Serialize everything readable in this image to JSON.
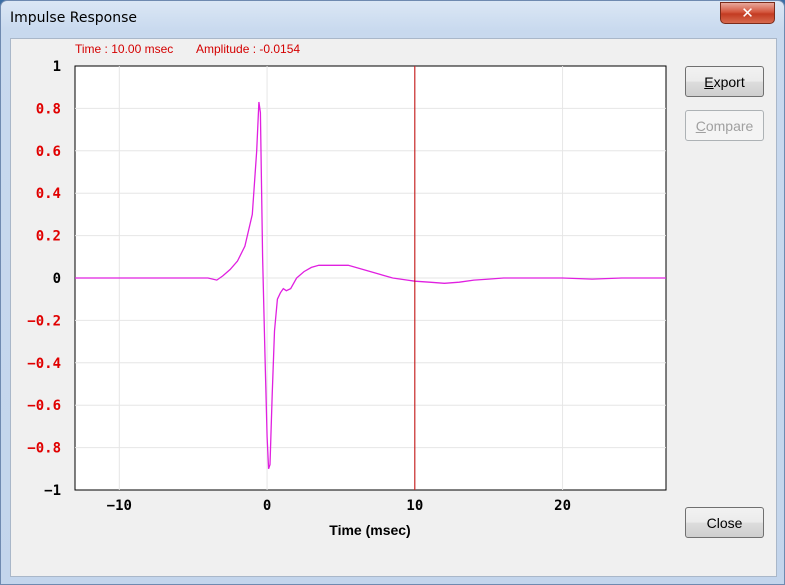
{
  "window": {
    "title": "Impulse Response",
    "close_glyph": "✕"
  },
  "readout": {
    "time": "Time : 10.00 msec",
    "amplitude": "Amplitude : -0.0154"
  },
  "buttons": {
    "export_label": "Export",
    "export_mnemonic": "E",
    "export_rest": "xport",
    "compare_label": "Compare",
    "compare_mnemonic": "C",
    "compare_rest": "ompare",
    "close_label": "Close"
  },
  "colors": {
    "curve": "#e020e0",
    "cursor": "#c00000",
    "tick_red": "#e00000",
    "grid": "#e6e6e6"
  },
  "chart_data": {
    "type": "line",
    "title": "",
    "xlabel": "Time (msec)",
    "ylabel": "",
    "xlim": [
      -13,
      27
    ],
    "ylim": [
      -1,
      1
    ],
    "x_ticks": [
      -10,
      0,
      10,
      20
    ],
    "x_tick_labels": [
      "−10",
      "0",
      "10",
      "20"
    ],
    "y_ticks": [
      1,
      0.8,
      0.6,
      0.4,
      0.2,
      0,
      -0.2,
      -0.4,
      -0.6,
      -0.8,
      -1
    ],
    "y_tick_labels": [
      "1",
      "0.8",
      "0.6",
      "0.4",
      "0.2",
      "0",
      "−0.2",
      "−0.4",
      "−0.6",
      "−0.8",
      "−1"
    ],
    "y_tick_red": [
      false,
      true,
      true,
      true,
      true,
      false,
      true,
      true,
      true,
      true,
      false
    ],
    "grid": true,
    "cursor_x": 10.0,
    "series": [
      {
        "x": [
          -13,
          -4.0,
          -3.4,
          -3.0,
          -2.5,
          -2.0,
          -1.5,
          -1.0,
          -0.7,
          -0.55,
          -0.45,
          -0.3,
          -0.15,
          0.0,
          0.1,
          0.2,
          0.35,
          0.5,
          0.7,
          0.9,
          1.1,
          1.3,
          1.6,
          2.0,
          2.5,
          3.0,
          3.5,
          4.5,
          5.5,
          6.5,
          7.5,
          8.5,
          9.5,
          10.0,
          11.0,
          12.0,
          13.0,
          14.0,
          15.0,
          16.0,
          18.0,
          20.0,
          22.0,
          24.0,
          27.0
        ],
        "y": [
          0,
          0,
          -0.01,
          0.01,
          0.04,
          0.08,
          0.15,
          0.3,
          0.6,
          0.83,
          0.78,
          0.1,
          -0.35,
          -0.75,
          -0.9,
          -0.88,
          -0.55,
          -0.25,
          -0.1,
          -0.07,
          -0.05,
          -0.06,
          -0.05,
          0.0,
          0.03,
          0.05,
          0.06,
          0.06,
          0.06,
          0.04,
          0.02,
          0.0,
          -0.01,
          -0.015,
          -0.02,
          -0.025,
          -0.02,
          -0.01,
          -0.005,
          0.0,
          0.0,
          0.0,
          -0.005,
          0.0,
          0.0
        ]
      }
    ]
  }
}
